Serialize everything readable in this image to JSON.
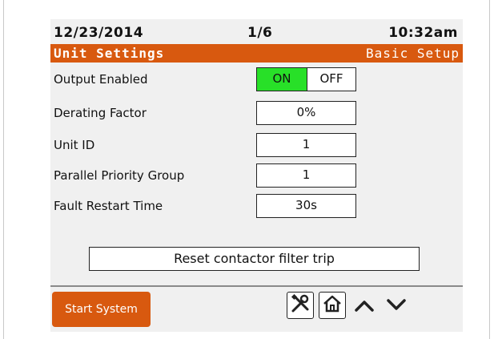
{
  "status": {
    "date": "12/23/2014",
    "page": "1/6",
    "time": "10:32am"
  },
  "title": {
    "left": "Unit Settings",
    "right": "Basic Setup"
  },
  "settings": {
    "output_enabled": {
      "label": "Output Enabled",
      "on": "ON",
      "off": "OFF",
      "selected": "ON"
    },
    "derating": {
      "label": "Derating Factor",
      "value": "0%"
    },
    "unit_id": {
      "label": "Unit ID",
      "value": "1"
    },
    "parallel": {
      "label": "Parallel Priority Group",
      "value": "1"
    },
    "fault": {
      "label": "Fault Restart Time",
      "value": "30s"
    }
  },
  "reset_button": "Reset contactor filter trip",
  "footer": {
    "start_button": "Start System",
    "icons": [
      "tools-icon",
      "home-icon",
      "chevron-up-icon",
      "chevron-down-icon"
    ]
  },
  "colors": {
    "accent": "#d8590f",
    "on_green": "#28e028"
  }
}
